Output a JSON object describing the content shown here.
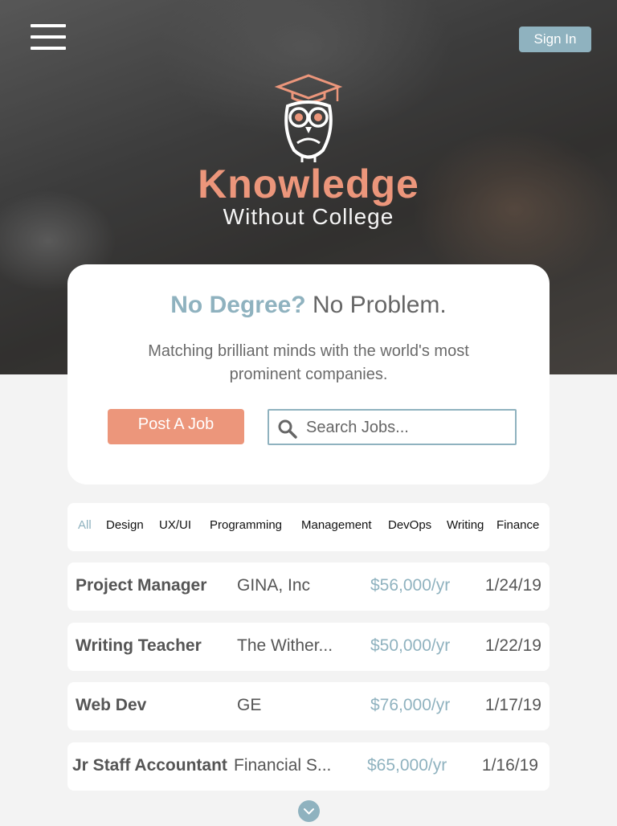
{
  "header": {
    "menu_icon": "hamburger-menu-icon",
    "sign_in_label": "Sign In"
  },
  "brand": {
    "logo_icon": "owl-graduation-cap-icon",
    "name": "Knowledge",
    "tagline": "Without College"
  },
  "hero_card": {
    "headline_accent": "No Degree?",
    "headline_rest": "No Problem.",
    "subline": "Matching brilliant minds with the world's most prominent companies.",
    "post_job_label": "Post A Job",
    "search_placeholder": "Search Jobs...",
    "search_icon": "search-icon"
  },
  "filters": [
    {
      "label": "All",
      "active": true
    },
    {
      "label": "Design",
      "active": false
    },
    {
      "label": "UX/UI",
      "active": false
    },
    {
      "label": "Programming",
      "active": false
    },
    {
      "label": "Management",
      "active": false
    },
    {
      "label": "DevOps",
      "active": false
    },
    {
      "label": "Writing",
      "active": false
    },
    {
      "label": "Finance",
      "active": false
    }
  ],
  "jobs": [
    {
      "title": "Project Manager",
      "company": "GINA, Inc",
      "salary": "$56,000/yr",
      "date": "1/24/19"
    },
    {
      "title": "Writing Teacher",
      "company": "The Wither...",
      "salary": "$50,000/yr",
      "date": "1/22/19"
    },
    {
      "title": "Web Dev",
      "company": "GE",
      "salary": "$76,000/yr",
      "date": "1/17/19"
    },
    {
      "title": "Jr Staff Accountant",
      "company": "Financial S...",
      "salary": "$65,000/yr",
      "date": "1/16/19"
    }
  ],
  "scroll_icon": "chevron-down-icon",
  "colors": {
    "accent_blue": "#8fb2bf",
    "accent_coral": "#ec967b",
    "page_bg": "#f3f3f3"
  }
}
